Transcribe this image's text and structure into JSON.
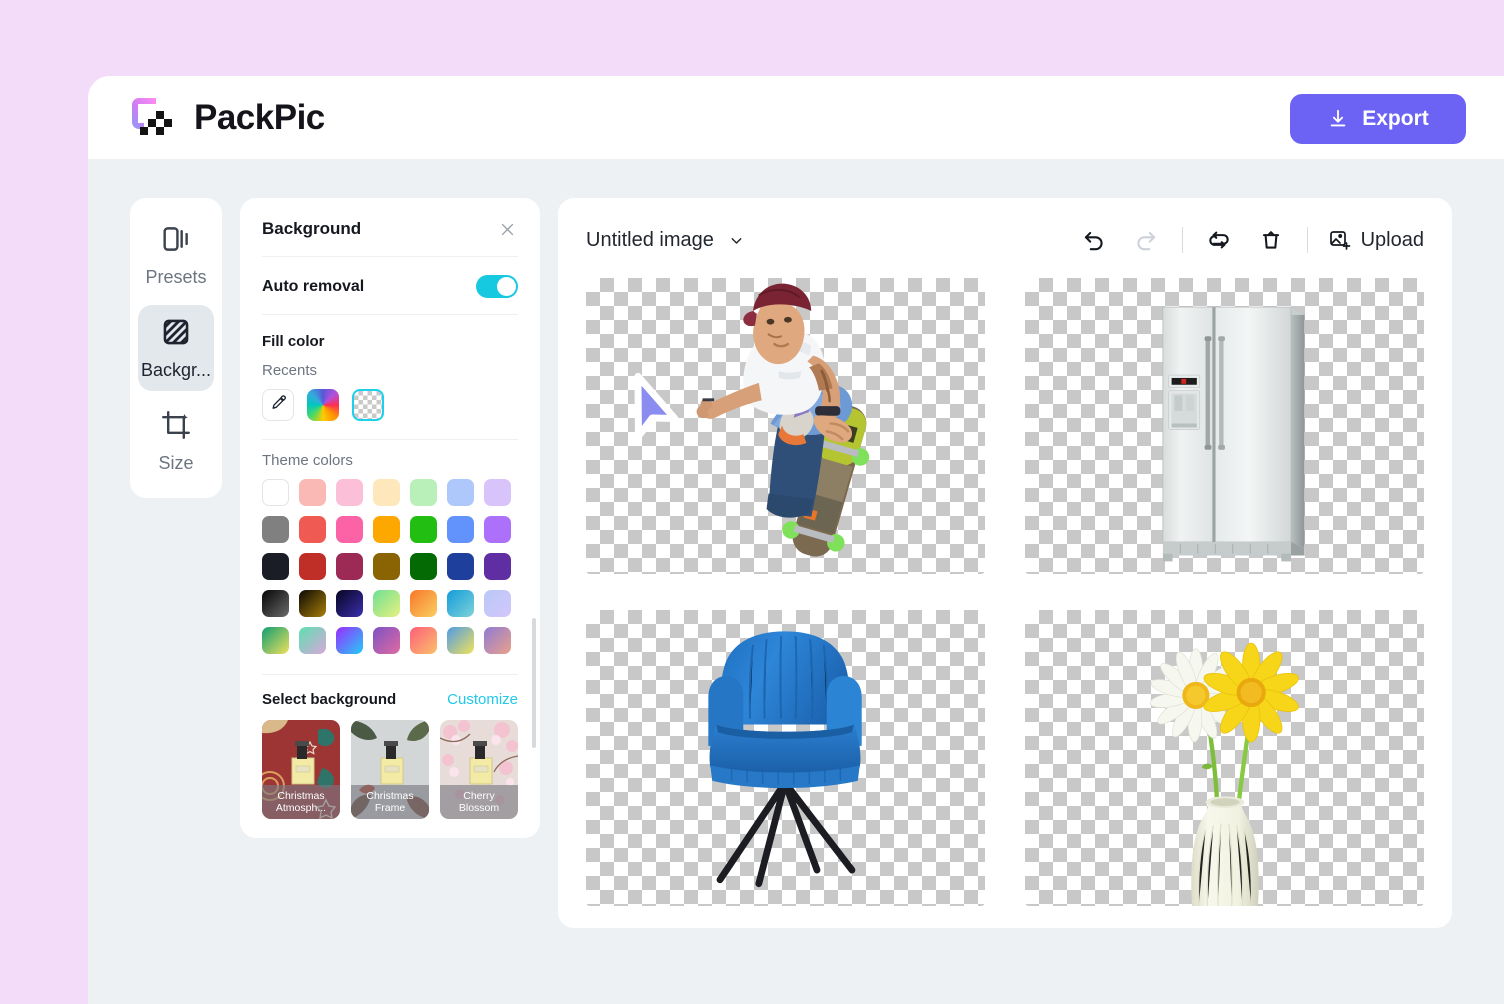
{
  "app": {
    "brand_name": "PackPic",
    "logo_icon": "packpic-logo-icon",
    "export_label": "Export",
    "export_icon": "download-icon",
    "accent_color": "#6c63f5",
    "page_background": "#f3dcfa"
  },
  "rail": {
    "items": [
      {
        "label": "Presets",
        "icon": "presets-icon",
        "active": false
      },
      {
        "label": "Backgr...",
        "icon": "background-hatch-icon",
        "active": true
      },
      {
        "label": "Size",
        "icon": "crop-sparkle-icon",
        "active": false
      }
    ]
  },
  "background_panel": {
    "title": "Background",
    "close_icon": "close-icon",
    "auto_removal_label": "Auto removal",
    "auto_removal_on": true,
    "toggle_color": "#16c9e0",
    "fill_color_title": "Fill color",
    "recents_title": "Recents",
    "recents": [
      {
        "name": "eyedropper-swatch",
        "icon": "eyedropper-icon",
        "color": "#ffffff"
      },
      {
        "name": "rainbow-picker-swatch",
        "icon": "color-wheel-icon",
        "color": "rainbow"
      },
      {
        "name": "transparent-swatch",
        "icon": "checkerboard-icon",
        "color": "transparent",
        "selected": true
      }
    ],
    "theme_colors_title": "Theme colors",
    "theme_colors": [
      [
        "#ffffff",
        "#fbb9b5",
        "#fbc0d8",
        "#fde7bb",
        "#b9f0b9",
        "#afc8fb",
        "#d8c4fb"
      ],
      [
        "#808080",
        "#ef5a52",
        "#fc63a6",
        "#fca800",
        "#22bf12",
        "#6292fb",
        "#ac70fb"
      ],
      [
        "#1a1d26",
        "#bf2f28",
        "#9c2a55",
        "#8a6302",
        "#046a03",
        "#1e3f9b",
        "#5f2ea3"
      ],
      [
        "linear-gradient(135deg,#050505,#6b6b6b)",
        "linear-gradient(135deg,#0a0804,#a97f08)",
        "linear-gradient(135deg,#070420,#3b2fae)",
        "linear-gradient(135deg,#6de093,#e8f07f)",
        "linear-gradient(135deg,#f8772a,#f9cf60)",
        "linear-gradient(135deg,#139bdb,#7fd3d8)",
        "linear-gradient(135deg,#b9c8f7,#d3c7fb)"
      ],
      [
        "linear-gradient(135deg,#0f9e72,#f0e05d)",
        "linear-gradient(135deg,#5ce0b0,#d9a6d9)",
        "linear-gradient(135deg,#9b2bff,#22cdf7)",
        "linear-gradient(135deg,#7d52c4,#e06aa0)",
        "linear-gradient(135deg,#fc5f7a,#fbc06a)",
        "linear-gradient(135deg,#4f9ae6,#f1e35a)",
        "linear-gradient(135deg,#8f7bd6,#eba088)"
      ]
    ],
    "select_background_title": "Select background",
    "customize_label": "Customize",
    "customize_color": "#1fc9e8",
    "backgrounds": [
      {
        "label": "Christmas Atmosph...",
        "theme": "christmas-red"
      },
      {
        "label": "Christmas Frame",
        "theme": "christmas-frame"
      },
      {
        "label": "Cherry Blossom",
        "theme": "cherry-blossom"
      }
    ]
  },
  "canvas": {
    "document_title": "Untitled image",
    "title_chevron_icon": "chevron-down-icon",
    "tools": [
      {
        "name": "undo-button",
        "icon": "undo-icon",
        "enabled": true
      },
      {
        "name": "redo-button",
        "icon": "redo-icon",
        "enabled": false
      },
      {
        "name": "reset-button",
        "icon": "loop-refresh-icon",
        "enabled": true
      },
      {
        "name": "delete-button",
        "icon": "trash-icon",
        "enabled": true
      }
    ],
    "upload_label": "Upload",
    "upload_icon": "image-plus-icon",
    "images": [
      {
        "name": "skateboarder-image",
        "alt": "Man doing skateboard trick",
        "transparent": true
      },
      {
        "name": "refrigerator-image",
        "alt": "Stainless steel side-by-side refrigerator",
        "transparent": true
      },
      {
        "name": "armchair-image",
        "alt": "Blue fabric armchair with black legs",
        "transparent": true
      },
      {
        "name": "flower-vase-image",
        "alt": "Daisy and yellow flower in white vase",
        "transparent": true
      }
    ]
  },
  "cursor": {
    "name": "mouse-pointer",
    "color": "#8b8cf0"
  }
}
